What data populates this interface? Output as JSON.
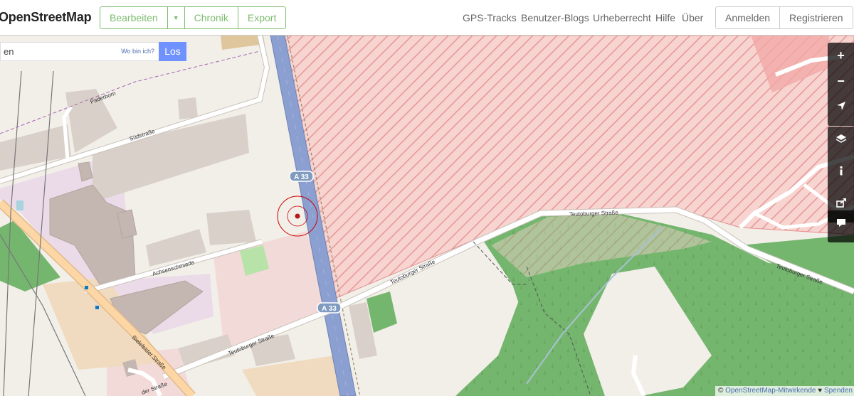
{
  "header": {
    "brand": "OpenStreetMap",
    "edit_label": "Bearbeiten",
    "history_label": "Chronik",
    "export_label": "Export",
    "nav": [
      "GPS-Tracks",
      "Benutzer-Blogs",
      "Urheberrecht",
      "Hilfe",
      "Über"
    ],
    "login_label": "Anmelden",
    "signup_label": "Registrieren"
  },
  "search": {
    "value": "en",
    "where_label": "Wo bin ich?",
    "go_label": "Los"
  },
  "map_controls": {
    "zoom_in": "+",
    "zoom_out": "−"
  },
  "map": {
    "labels": {
      "paderborn": "Paderborn",
      "suedstrasse": "Südstraße",
      "a33_top": "A 33",
      "a33_bottom": "A 33",
      "achsenschmiede": "Achsenschmiede",
      "teuto_1": "Teutoburger Straße",
      "teuto_2": "Teutoburger Straße",
      "teuto_3": "Teutoburger Straße",
      "teuto_4": "Teutoburger Straße",
      "bielefelder": "Bielefelder Straße",
      "bielefelder_2": "der Straße"
    },
    "colors": {
      "background": "#f2efe9",
      "industrial": "#ebdbe8",
      "motorway": "#8b9fd1",
      "forest": "#75b66f",
      "restricted": "#f4c6c2",
      "restricted_hatch": "#e58f8f",
      "building": "#d9d0c9",
      "commercial": "#f2dad9"
    }
  },
  "attribution": {
    "prefix": "©",
    "link": "OpenStreetMap-Mitwirkende",
    "heart": "♥",
    "donate": "Spenden"
  }
}
